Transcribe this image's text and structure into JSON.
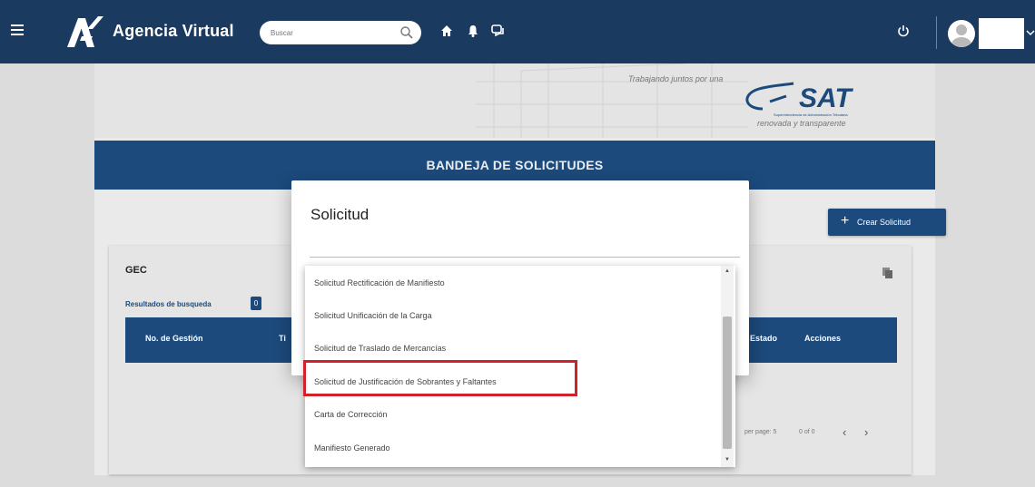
{
  "header": {
    "app_title": "Agencia Virtual",
    "search_placeholder": "Buscar",
    "icons": [
      "menu-icon",
      "search-icon",
      "home-icon",
      "bell-icon",
      "chat-icon",
      "power-icon",
      "chevron-down-icon"
    ]
  },
  "banner": {
    "tagline": "Trabajando juntos por una",
    "logo_text": "SAT",
    "logo_caption": "Superintendencia de Administración Tributaria",
    "subline": "renovada y transparente"
  },
  "section": {
    "title": "BANDEJA DE SOLICITUDES",
    "create_button": "Crear Solicitud"
  },
  "gec": {
    "title": "GEC",
    "results_label": "Resultados de busqueda",
    "results_count": "0",
    "columns": [
      "No. de Gestión",
      "Ti",
      "Estado",
      "Acciones"
    ],
    "pager": {
      "items_per_page": "per page: 5",
      "range": "0 of 0"
    }
  },
  "modal": {
    "title": "Solicitud",
    "options": [
      "Solicitud Rectificación de Manifiesto",
      "Solicitud Unificación de la Carga",
      "Solicitud de Traslado de Mercancías",
      "Solicitud de Justificación de Sobrantes y Faltantes",
      "Carta de Corrección",
      "Manifiesto Generado"
    ],
    "highlighted_option_index": 3,
    "highlight_color": "#d1222c"
  },
  "colors": {
    "topbar": "#1b3a5f",
    "primary": "#1c4a7c",
    "background": "#dcdcdc"
  }
}
